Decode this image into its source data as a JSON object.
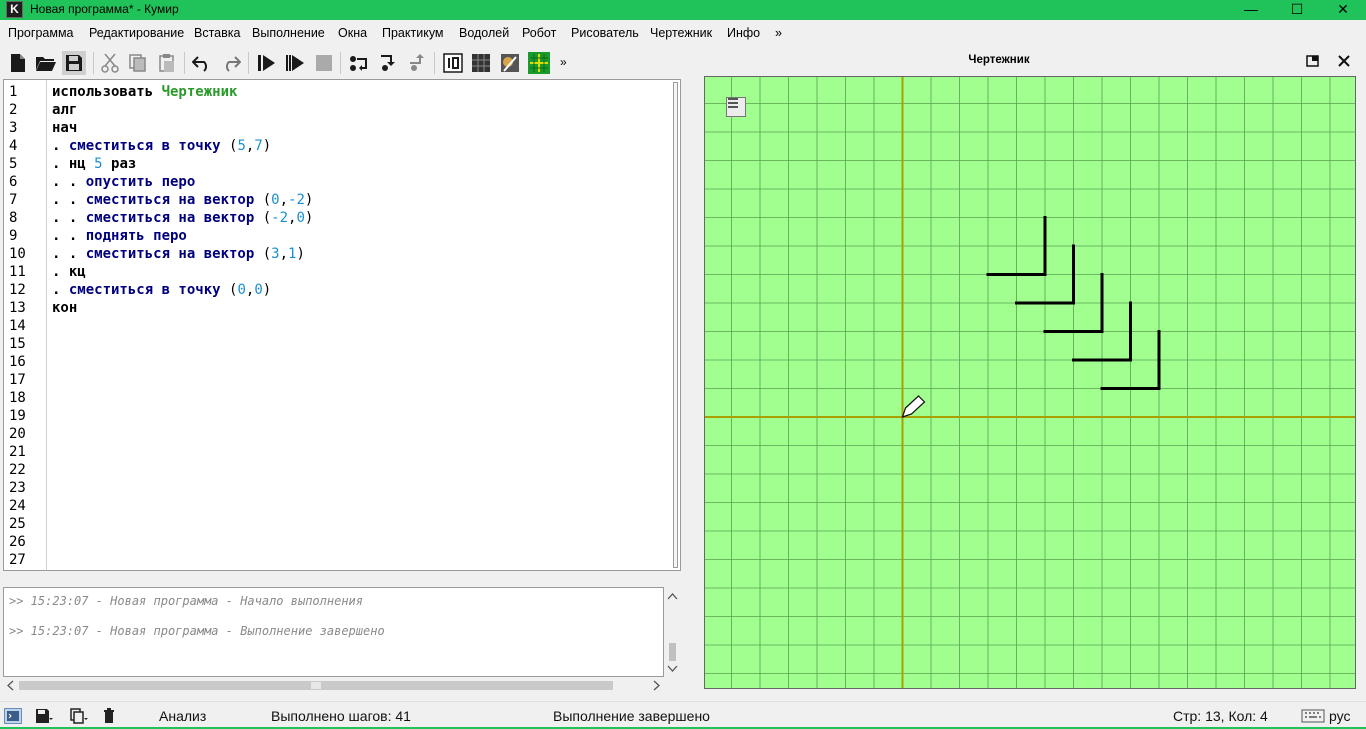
{
  "window": {
    "title": "Новая программа* - Кумир",
    "icon_letter": "K",
    "minimize": "—",
    "maximize": "☐",
    "close": "✕"
  },
  "menu": [
    "Программа",
    "Редактирование",
    "Вставка",
    "Выполнение",
    "Окна",
    "Практикум",
    "Водолей",
    "Робот",
    "Рисователь",
    "Чертежник",
    "Инфо",
    "»"
  ],
  "toolbar": {
    "overflow": "»",
    "icons": [
      "new-file-icon",
      "open-file-icon",
      "save-icon",
      "cut-icon",
      "copy-icon",
      "paste-icon",
      "undo-icon",
      "redo-icon",
      "run-icon",
      "step-run-icon",
      "stop-icon",
      "step-over-icon",
      "step-into-icon",
      "step-out-icon",
      "counter-icon",
      "robot-grid-icon",
      "painter-icon",
      "drawer-icon"
    ]
  },
  "editor": {
    "line_numbers": [
      "1",
      "2",
      "3",
      "4",
      "5",
      "6",
      "7",
      "8",
      "9",
      "10",
      "11",
      "12",
      "13",
      "14",
      "15",
      "16",
      "17",
      "18",
      "19",
      "20",
      "21",
      "22",
      "23",
      "24",
      "25",
      "26",
      "27"
    ],
    "lines": [
      [
        {
          "t": "использовать ",
          "c": "kw"
        },
        {
          "t": "Чертежник",
          "c": "green"
        }
      ],
      [
        {
          "t": "алг",
          "c": "kw"
        }
      ],
      [
        {
          "t": "нач",
          "c": "kw"
        }
      ],
      [
        {
          "t": ". ",
          "c": "dot"
        },
        {
          "t": "сместиться в точку ",
          "c": "blue"
        },
        {
          "t": "(",
          "c": "plain"
        },
        {
          "t": "5",
          "c": "num"
        },
        {
          "t": ",",
          "c": "plain"
        },
        {
          "t": "7",
          "c": "num"
        },
        {
          "t": ")",
          "c": "plain"
        }
      ],
      [
        {
          "t": ". ",
          "c": "dot"
        },
        {
          "t": "нц ",
          "c": "kw"
        },
        {
          "t": "5",
          "c": "num"
        },
        {
          "t": " раз",
          "c": "kw"
        }
      ],
      [
        {
          "t": ". . ",
          "c": "dot"
        },
        {
          "t": "опустить перо",
          "c": "blue"
        }
      ],
      [
        {
          "t": ". . ",
          "c": "dot"
        },
        {
          "t": "сместиться на вектор ",
          "c": "blue"
        },
        {
          "t": "(",
          "c": "plain"
        },
        {
          "t": "0",
          "c": "num"
        },
        {
          "t": ",",
          "c": "plain"
        },
        {
          "t": "-2",
          "c": "num"
        },
        {
          "t": ")",
          "c": "plain"
        }
      ],
      [
        {
          "t": ". . ",
          "c": "dot"
        },
        {
          "t": "сместиться на вектор ",
          "c": "blue"
        },
        {
          "t": "(",
          "c": "plain"
        },
        {
          "t": "-2",
          "c": "num"
        },
        {
          "t": ",",
          "c": "plain"
        },
        {
          "t": "0",
          "c": "num"
        },
        {
          "t": ")",
          "c": "plain"
        }
      ],
      [
        {
          "t": ". . ",
          "c": "dot"
        },
        {
          "t": "поднять перо",
          "c": "blue"
        }
      ],
      [
        {
          "t": ". . ",
          "c": "dot"
        },
        {
          "t": "сместиться на вектор ",
          "c": "blue"
        },
        {
          "t": "(",
          "c": "plain"
        },
        {
          "t": "3",
          "c": "num"
        },
        {
          "t": ",",
          "c": "plain"
        },
        {
          "t": "1",
          "c": "num"
        },
        {
          "t": ")",
          "c": "plain"
        }
      ],
      [
        {
          "t": ". ",
          "c": "dot"
        },
        {
          "t": "кц",
          "c": "kw"
        }
      ],
      [
        {
          "t": ". ",
          "c": "dot"
        },
        {
          "t": "сместиться в точку ",
          "c": "blue"
        },
        {
          "t": "(",
          "c": "plain"
        },
        {
          "t": "0",
          "c": "num"
        },
        {
          "t": ",",
          "c": "plain"
        },
        {
          "t": "0",
          "c": "num"
        },
        {
          "t": ")",
          "c": "plain"
        }
      ],
      [
        {
          "t": "кон",
          "c": "kw"
        }
      ]
    ]
  },
  "console": {
    "lines": [
      ">> 15:23:07 - Новая программа - Начало выполнения",
      ">> 15:23:07 - Новая программа - Выполнение завершено"
    ]
  },
  "drawer": {
    "title": "Чертежник",
    "background_color": "#a0ff8f",
    "grid_color": "#5aa050",
    "axis_color": "#a8a000",
    "segments": [
      {
        "from": [
          5,
          7
        ],
        "to": [
          5,
          5
        ]
      },
      {
        "from": [
          5,
          5
        ],
        "to": [
          3,
          5
        ]
      },
      {
        "from": [
          6,
          6
        ],
        "to": [
          6,
          4
        ]
      },
      {
        "from": [
          6,
          4
        ],
        "to": [
          4,
          4
        ]
      },
      {
        "from": [
          7,
          5
        ],
        "to": [
          7,
          3
        ]
      },
      {
        "from": [
          7,
          3
        ],
        "to": [
          5,
          3
        ]
      },
      {
        "from": [
          8,
          4
        ],
        "to": [
          8,
          2
        ]
      },
      {
        "from": [
          8,
          2
        ],
        "to": [
          6,
          2
        ]
      },
      {
        "from": [
          9,
          3
        ],
        "to": [
          9,
          1
        ]
      },
      {
        "from": [
          9,
          1
        ],
        "to": [
          7,
          1
        ]
      }
    ],
    "pen_position": [
      0,
      0
    ]
  },
  "status": {
    "analysis": "Анализ",
    "steps": "Выполнено шагов: 41",
    "state": "Выполнение завершено",
    "cursor": "Стр: 13, Кол: 4",
    "lang": "рус"
  }
}
